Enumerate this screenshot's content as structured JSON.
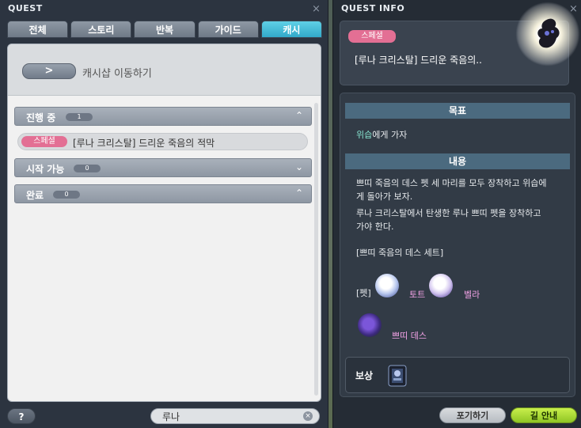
{
  "quest_window": {
    "title": "QUEST",
    "close_glyph": "×",
    "tabs": [
      {
        "label": "전체",
        "active": false
      },
      {
        "label": "스토리",
        "active": false
      },
      {
        "label": "반복",
        "active": false
      },
      {
        "label": "가이드",
        "active": false
      },
      {
        "label": "캐시",
        "active": true
      }
    ],
    "goto_button_glyph": ">",
    "goto_label": "캐시샵 이동하기",
    "sections": [
      {
        "title": "진행 중",
        "count": "1",
        "chevron": "⌃"
      },
      {
        "title": "시작 가능",
        "count": "0",
        "chevron": "⌄"
      },
      {
        "title": "완료",
        "count": "0",
        "chevron": "⌃"
      }
    ],
    "quest_item": {
      "badge": "스페셜",
      "name": "[루나 크리스탈] 드리운 죽음의 적막"
    },
    "help_label": "?",
    "search": {
      "value": "루나",
      "placeholder": ""
    },
    "clear_glyph": "×"
  },
  "info_window": {
    "title": "QUEST INFO",
    "close_glyph": "×",
    "badge": "스페셜",
    "quest_name": "[루나 크리스탈] 드리운 죽음의..",
    "goal_header": "목표",
    "goal_highlight": "위습",
    "goal_rest": "에게 가자",
    "content_header": "내용",
    "content_line1": "쁘띠 죽음의 데스 펫 세 마리를 모두 장착하고 위습에",
    "content_line2": "게 돌아가 보자.",
    "content_line3": "루나 크리스탈에서 탄생한 루나 쁘띠 펫을 장착하고",
    "content_line4": "가야 한다.",
    "set_label": "[쁘띠 죽음의 데스 세트]",
    "pet_prefix": "[펫]",
    "pets": [
      "토트",
      "벨라",
      "쁘띠 데스"
    ],
    "reward_label": "보상",
    "giveup_button": "포기하기",
    "guide_button": "길 안내"
  },
  "colors": {
    "special_badge": "#e36f94",
    "active_tab": "#32a9c9",
    "guide_button": "#8fc524",
    "section_header": "#4b6a7f"
  }
}
